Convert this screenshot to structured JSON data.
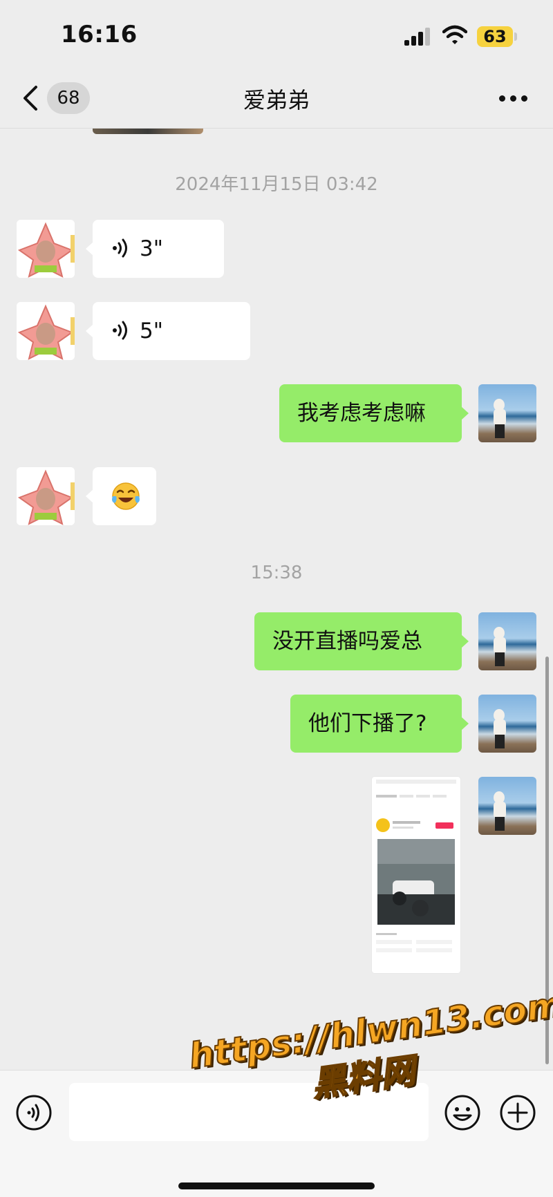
{
  "status_bar": {
    "time": "16:16",
    "battery": "63"
  },
  "nav": {
    "unread_count": "68",
    "title": "爱弟弟"
  },
  "messages": {
    "timestamp_1": "2024年11月15日 03:42",
    "voice_1_duration": "3\"",
    "voice_2_duration": "5\"",
    "text_1": "我考虑考虑嘛",
    "emoji_1": "laughing-crying-emoji",
    "timestamp_2": "15:38",
    "text_2": "没开直播吗爱总",
    "text_3": "他们下播了?",
    "image_1": "screenshot-image"
  },
  "watermark": {
    "url": "https://hlwn13.com",
    "site": "黑料网"
  },
  "colors": {
    "sent_bubble": "#95ec69",
    "received_bubble": "#ffffff",
    "background": "#ededed",
    "watermark": "#f5a623"
  }
}
